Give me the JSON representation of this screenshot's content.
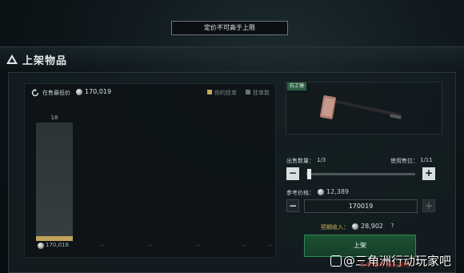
{
  "toast": {
    "message": "定价不可高于上限"
  },
  "header": {
    "title": "上架物品",
    "icon": "warning-triangle-icon"
  },
  "chart": {
    "refresh_icon": "refresh-icon",
    "lowest_label": "在售最低价",
    "lowest_value": "170,019",
    "legend_mine": "你的挂单",
    "legend_order": "挂单数",
    "bar_count": "18",
    "x_tick": "170,018",
    "x_dashes": [
      "--",
      "--",
      "--",
      "--",
      "--"
    ]
  },
  "chart_data": {
    "type": "bar",
    "categories": [
      "170,018",
      "--",
      "--",
      "--",
      "--",
      "--"
    ],
    "series": [
      {
        "name": "挂单数",
        "values": [
          18,
          0,
          0,
          0,
          0,
          0
        ]
      },
      {
        "name": "你的挂单",
        "values": [
          1,
          0,
          0,
          0,
          0,
          0
        ]
      }
    ]
  },
  "item": {
    "name": "石工锤"
  },
  "sell": {
    "qty_label": "出售数量：",
    "qty_value": "1/3",
    "slot_label": "使用售位：",
    "slot_value": "1/11",
    "minus": "−",
    "plus": "+",
    "slider_fraction": 0.02,
    "ref_label": "参考价格：",
    "ref_value": "12,389",
    "price_value": "170019",
    "expect_label": "预期收入：",
    "expect_value": "28,902",
    "help": "?",
    "list_button": "上架"
  },
  "watermark": {
    "text": "@三角洲行动玩家吧",
    "sub": "头条 @手游玩家吧"
  }
}
